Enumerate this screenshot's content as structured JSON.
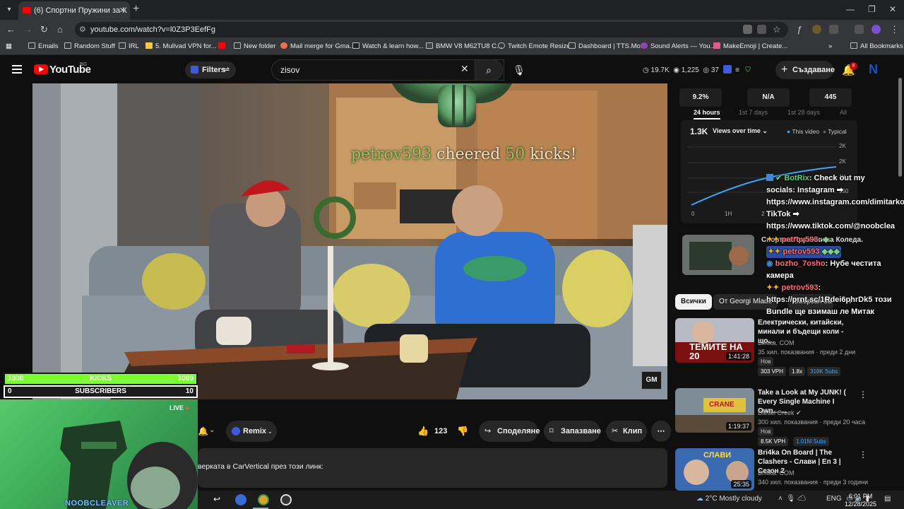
{
  "browser": {
    "tab_title": "(6) Спортни Пружини за К",
    "url": "youtube.com/watch?v=l0Z3P3EefFg",
    "bookmarks": [
      "Emails",
      "Random Stuff",
      "IRL",
      "5. Mullvad VPN for...",
      "New folder",
      "Mail merge for Gma...",
      "Watch & learn how...",
      "BMW V8 M62TU8 C...",
      "Twitch Emote Resizer",
      "Dashboard | TTS.Mo...",
      "Sound Alerts — You...",
      "MakeEmoji | Create..."
    ],
    "all_bookmarks": "All Bookmarks"
  },
  "yt": {
    "logo": "YouTube",
    "country": "BG",
    "filters": "Filters",
    "search_value": "zisov",
    "stats": {
      "views": "19.7K",
      "likes": "1,225",
      "comments": "37"
    },
    "create": "Създаване",
    "notifications": "6",
    "avatar_letter": "N"
  },
  "video": {
    "cheer_user": "petrov593",
    "cheer_mid": "cheered",
    "cheer_amount": "50",
    "cheer_end": "kicks!",
    "gm_logo": "GM"
  },
  "actions": {
    "remix": "Remix",
    "likes": "123",
    "share": "Споделяне",
    "save": "Запазване",
    "clip": "Клип"
  },
  "description": "верката в CarVertical през този линк:",
  "overlay": {
    "kicks_left": "1000",
    "kicks_label": "KICKS",
    "kicks_right": "1000",
    "subs_left": "0",
    "subs_label": "SUBSCRIBERS",
    "subs_right": "10",
    "live": "LIVE",
    "streamer": "NOOBCLEAVER"
  },
  "analytics": {
    "metrics": [
      "9.2%",
      "N/A",
      "445"
    ],
    "ranges": [
      "24 hours",
      "1st 7 days",
      "1st 28 days",
      "All"
    ],
    "views_total": "1.3K",
    "views_dropdown": "Views over time",
    "legend_this": "This video",
    "legend_typical": "Typical",
    "y_ticks": [
      "2K",
      "2K",
      "1K",
      "550"
    ],
    "x_ticks": [
      "0",
      "1H",
      "2"
    ]
  },
  "chat_bg_title": "Спортни Пружини за Коледа.",
  "chips": [
    "Всички",
    "От Georgi Mlade",
    "Свързани",
    "За"
  ],
  "recs": [
    {
      "title": "Електрически, китайски, минали и бъдещи коли - що...",
      "channel": "Bri4ka. COM",
      "meta": "35 хил. показвания · преди 2 дни",
      "badge": "Нов",
      "stats": [
        "303 VPH",
        "1.8x",
        "318K Subs"
      ],
      "duration": "1:41:28",
      "thumb_text": "ТЕМИТЕ НА 20"
    },
    {
      "title": "Take a Look at My JUNK! ( Every Single Machine I Own.......",
      "channel": "Diesel Creek",
      "meta": "300 хил. показвания · преди 20 часа",
      "badge": "Нов",
      "stats": [
        "8.5K VPH",
        "1.01M Subs"
      ],
      "duration": "1:19:37",
      "thumb_text": "CRANE"
    },
    {
      "title": "Bri4ka On Board | The Clashers - Слави | Еп 3 | Сезон 2",
      "channel": "Bri4ka. COM",
      "meta": "340 хил. показвания · преди 3 години",
      "duration": "25:35",
      "thumb_text": "СЛАВИ"
    }
  ],
  "chat": [
    {
      "user": "BotRix",
      "msg": ": Check out my socials: Instagram ➡ https://www.instagram.com/dimitarkozhuharov TikTok ➡ https://www.tiktok.com/@noobclea"
    },
    {
      "user": "petrov593",
      "msg": ":"
    },
    {
      "user": "petrov593",
      "msg": ""
    },
    {
      "user": "bozho_7osho",
      "msg": ": Нубе честита камера"
    },
    {
      "user": "petrov593",
      "msg": ": https://prnt.sc/1Rdei6phrDk5 този Bundle ще взимаш ле Митак"
    }
  ],
  "taskbar": {
    "weather": "2°C  Mostly cloudy",
    "lang": "ENG",
    "time": "6:01 PM",
    "date": "12/28/2025"
  },
  "colors": {
    "yt_red": "#ff0000",
    "kicks_green": "#7ffb38",
    "cam_green": "#3fae5a",
    "chart_blue": "#3ea6ff"
  }
}
